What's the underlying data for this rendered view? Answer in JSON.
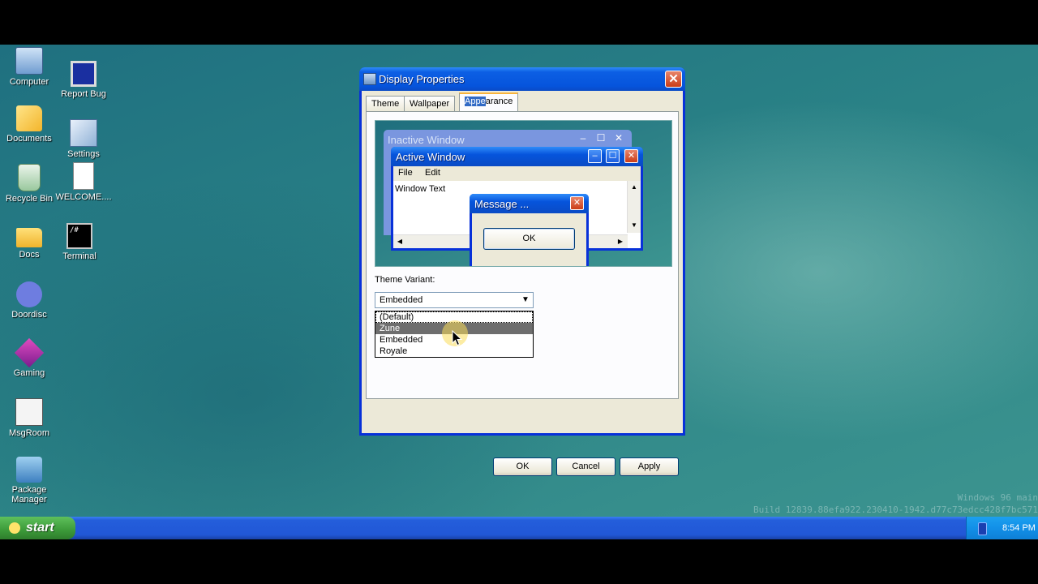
{
  "desktop": {
    "icons_left": [
      {
        "label": "Computer"
      },
      {
        "label": "Documents"
      },
      {
        "label": "Recycle Bin"
      },
      {
        "label": "Docs"
      },
      {
        "label": "Doordisc"
      },
      {
        "label": "Gaming"
      },
      {
        "label": "MsgRoom"
      },
      {
        "label": "Package Manager"
      }
    ],
    "icons_right": [
      {
        "label": "Report Bug"
      },
      {
        "label": "Settings"
      },
      {
        "label": "WELCOME...."
      },
      {
        "label": "Terminal",
        "glyph": "/#"
      }
    ],
    "watermark": [
      "Windows 96 main",
      "Build 12839.88efa922.230410-1942.d77c73edcc428f7bc571"
    ]
  },
  "taskbar": {
    "start_label": "start",
    "clock": "8:54 PM"
  },
  "dialog": {
    "title": "Display Properties",
    "close_glyph": "✕",
    "tabs": [
      {
        "label": "Theme"
      },
      {
        "label": "Wallpaper"
      },
      {
        "label_selected": "Appe",
        "label_rest": "arance"
      }
    ],
    "preview": {
      "inactive_title": "Inactive Window",
      "active_title": "Active Window",
      "menu": [
        "File",
        "Edit"
      ],
      "window_text": "Window Text",
      "message_title": "Message ...",
      "message_ok": "OK"
    },
    "variant": {
      "label": "Theme Variant:",
      "selected": "Embedded",
      "options": [
        "(Default)",
        "Zune",
        "Embedded",
        "Royale"
      ],
      "highlighted_index": 1
    },
    "buttons": {
      "ok": "OK",
      "cancel": "Cancel",
      "apply": "Apply"
    }
  }
}
